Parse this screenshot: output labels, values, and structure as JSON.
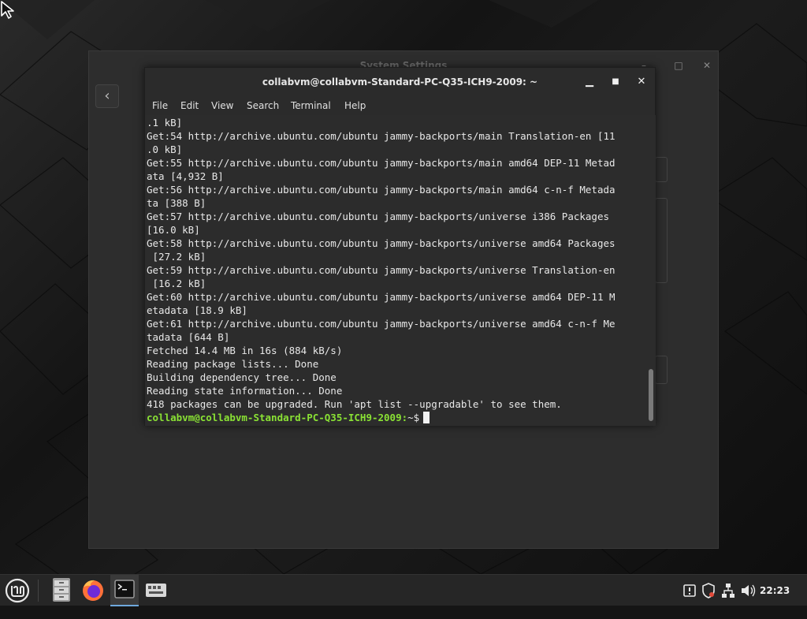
{
  "settings_window": {
    "title": "System Settings",
    "back_label": "‹",
    "controls": [
      "–",
      "□",
      "✕"
    ]
  },
  "terminal": {
    "title": "collabvm@collabvm-Standard-PC-Q35-ICH9-2009: ~",
    "minimize_label": "▁",
    "maximize_label": "■",
    "close_label": "✕",
    "menu": [
      "File",
      "Edit",
      "View",
      "Search",
      "Terminal",
      "Help"
    ],
    "lines": [
      ".1 kB]",
      "Get:54 http://archive.ubuntu.com/ubuntu jammy-backports/main Translation-en [11",
      ".0 kB]",
      "Get:55 http://archive.ubuntu.com/ubuntu jammy-backports/main amd64 DEP-11 Metad",
      "ata [4,932 B]",
      "Get:56 http://archive.ubuntu.com/ubuntu jammy-backports/main amd64 c-n-f Metada",
      "ta [388 B]",
      "Get:57 http://archive.ubuntu.com/ubuntu jammy-backports/universe i386 Packages",
      "[16.0 kB]",
      "Get:58 http://archive.ubuntu.com/ubuntu jammy-backports/universe amd64 Packages",
      " [27.2 kB]",
      "Get:59 http://archive.ubuntu.com/ubuntu jammy-backports/universe Translation-en",
      " [16.2 kB]",
      "Get:60 http://archive.ubuntu.com/ubuntu jammy-backports/universe amd64 DEP-11 M",
      "etadata [18.9 kB]",
      "Get:61 http://archive.ubuntu.com/ubuntu jammy-backports/universe amd64 c-n-f Me",
      "tadata [644 B]",
      "Fetched 14.4 MB in 16s (884 kB/s)",
      "Reading package lists... Done",
      "Building dependency tree... Done",
      "Reading state information... Done",
      "418 packages can be upgraded. Run 'apt list --upgradable' to see them."
    ],
    "prompt": "collabvm@collabvm-Standard-PC-Q35-ICH9-2009:",
    "prompt_suffix": "~$",
    "prompt_color": "#8ae234"
  },
  "taskbar": {
    "clock": "22:23",
    "apps": [
      "mint-menu-icon",
      "file-manager-icon",
      "firefox-icon",
      "terminal-icon",
      "settings-app-icon"
    ],
    "tray": [
      "update-manager-icon",
      "shield-icon",
      "network-icon",
      "volume-icon"
    ]
  },
  "colors": {
    "terminal_bg": "#2c2c2c",
    "taskbar_bg": "#262626",
    "accent_green": "#8ae234"
  }
}
